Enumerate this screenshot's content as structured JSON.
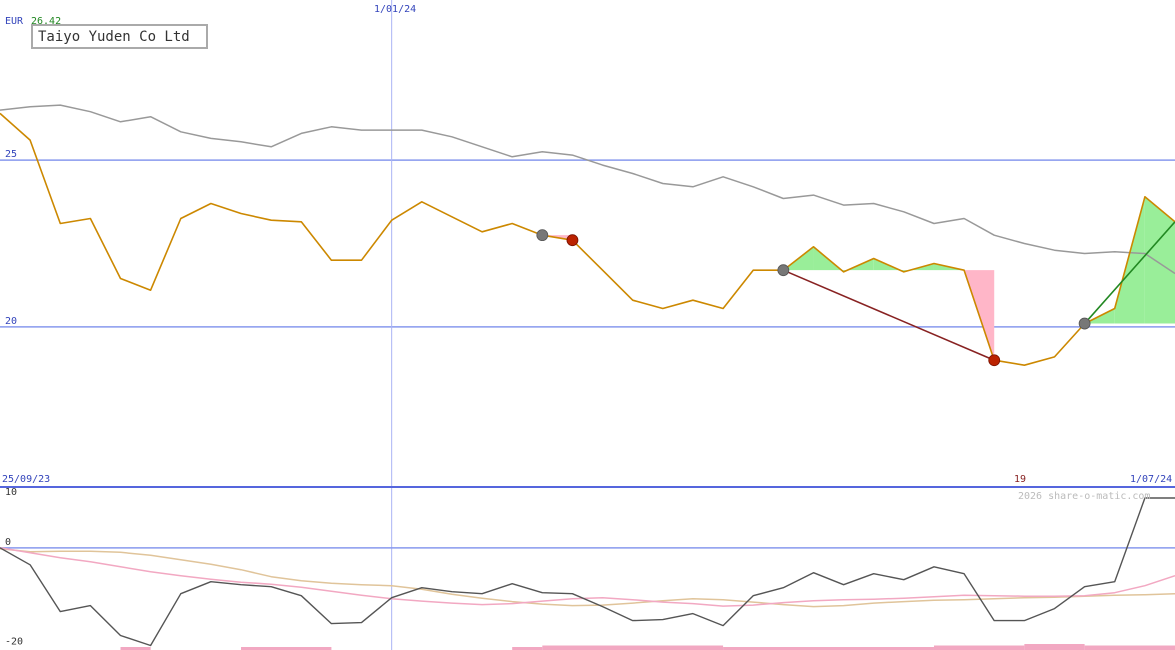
{
  "header": {
    "currency": "EUR",
    "last_price": "26.42",
    "company": "Taiyo Yuden Co Ltd"
  },
  "dates": {
    "start": "25/09/23",
    "mid": "1/01/24",
    "end": "1/07/24"
  },
  "copyright": "2026 share-o-matic.com",
  "marker_label": "19",
  "colors": {
    "price": "#cc8800",
    "average": "#999999",
    "hline": "#8899ee",
    "vline": "#aab4f4",
    "buy_fill": "#99ee99",
    "sell_fill": "#ffb6c8",
    "signal_down": "#882222",
    "signal_up": "#228822",
    "point_grey": "#777777",
    "point_red": "#bb2200",
    "osc_main": "#555555",
    "osc_pink": "#f2a8c2",
    "osc_tan": "#e0c49a",
    "last_price_color": "#228822",
    "label_blue": "#3344bb",
    "label_dark": "#882222"
  },
  "chart_data": [
    {
      "type": "line",
      "title": "Taiyo Yuden Co Ltd",
      "ylabel": "EUR",
      "yticks": [
        20,
        25
      ],
      "ylim": [
        15.2,
        29.8
      ],
      "xlim": [
        0,
        39
      ],
      "x_tick_labels": [
        {
          "x": 0,
          "label": "25/09/23"
        },
        {
          "x": 13,
          "label": "1/01/24"
        },
        {
          "x": 39,
          "label": "1/07/24"
        }
      ],
      "series": [
        {
          "key": "price",
          "values": [
            26.4,
            25.6,
            23.1,
            23.25,
            21.45,
            21.1,
            23.25,
            23.7,
            23.4,
            23.2,
            23.15,
            22.0,
            22.0,
            23.2,
            23.75,
            23.3,
            22.85,
            23.1,
            22.75,
            22.6,
            21.7,
            20.8,
            20.55,
            20.8,
            20.55,
            21.7,
            21.7,
            22.4,
            21.65,
            22.05,
            21.65,
            21.9,
            21.7,
            19.0,
            18.85,
            19.1,
            20.1,
            20.55,
            23.9,
            23.15
          ]
        },
        {
          "key": "average",
          "values": [
            26.5,
            26.6,
            26.65,
            26.45,
            26.15,
            26.3,
            25.85,
            25.65,
            25.55,
            25.4,
            25.8,
            26.0,
            25.9,
            25.9,
            25.9,
            25.7,
            25.4,
            25.1,
            25.25,
            25.15,
            24.85,
            24.6,
            24.3,
            24.2,
            24.5,
            24.2,
            23.85,
            23.95,
            23.65,
            23.7,
            23.45,
            23.1,
            23.25,
            22.75,
            22.5,
            22.3,
            22.2,
            22.25,
            22.2,
            21.6
          ]
        }
      ],
      "signals": [
        {
          "from_x": 26,
          "from_y": 21.7,
          "to_x": 33,
          "to_y": 19.0,
          "kind": "down"
        },
        {
          "from_x": 36,
          "from_y": 20.1,
          "to_x": 39,
          "to_y": 23.15,
          "kind": "up"
        }
      ],
      "points": [
        {
          "x": 18,
          "y": 22.75,
          "kind": "grey"
        },
        {
          "x": 19,
          "y": 22.6,
          "kind": "red"
        },
        {
          "x": 26,
          "y": 21.7,
          "kind": "grey"
        },
        {
          "x": 33,
          "y": 19.0,
          "kind": "red"
        },
        {
          "x": 36,
          "y": 20.1,
          "kind": "grey"
        }
      ],
      "marker": {
        "x": 33,
        "label": "19"
      }
    },
    {
      "type": "line",
      "yticks": [
        10,
        0,
        -20
      ],
      "ylim": [
        -20.5,
        12.2
      ],
      "xlim": [
        0,
        39
      ],
      "series": [
        {
          "key": "main",
          "values": [
            0,
            -3.4,
            -12.8,
            -11.6,
            -17.6,
            -19.6,
            -9.2,
            -6.8,
            -7.4,
            -7.8,
            -9.6,
            -15.2,
            -15.0,
            -10.0,
            -8.0,
            -8.8,
            -9.2,
            -7.2,
            -9.0,
            -9.2,
            -11.8,
            -14.6,
            -14.4,
            -13.2,
            -15.6,
            -9.6,
            -8.0,
            -5.0,
            -7.4,
            -5.2,
            -6.4,
            -3.8,
            -5.2,
            -14.6,
            -14.6,
            -12.2,
            -7.8,
            -6.8,
            10.0,
            10.0
          ]
        },
        {
          "key": "pink",
          "values": [
            0,
            -1.0,
            -2.0,
            -2.8,
            -3.8,
            -4.8,
            -5.6,
            -6.3,
            -6.9,
            -7.3,
            -7.9,
            -8.7,
            -9.5,
            -10.2,
            -10.7,
            -11.1,
            -11.4,
            -11.2,
            -10.7,
            -10.2,
            -10.0,
            -10.4,
            -10.9,
            -11.2,
            -11.7,
            -11.5,
            -11.0,
            -10.6,
            -10.4,
            -10.3,
            -10.1,
            -9.8,
            -9.5,
            -9.6,
            -9.7,
            -9.7,
            -9.6,
            -9.0,
            -7.6,
            -5.6
          ]
        },
        {
          "key": "tan",
          "values": [
            -0.2,
            -0.8,
            -0.7,
            -0.7,
            -0.9,
            -1.5,
            -2.4,
            -3.3,
            -4.4,
            -5.8,
            -6.6,
            -7.1,
            -7.4,
            -7.6,
            -8.3,
            -9.3,
            -10.1,
            -10.8,
            -11.3,
            -11.6,
            -11.5,
            -11.1,
            -10.6,
            -10.2,
            -10.4,
            -10.9,
            -11.4,
            -11.8,
            -11.6,
            -11.1,
            -10.8,
            -10.5,
            -10.4,
            -10.2,
            -10.0,
            -9.9,
            -9.7,
            -9.5,
            -9.4,
            -9.2
          ]
        }
      ],
      "bars": [
        {
          "from_x": 4,
          "to_x": 5,
          "level": 1
        },
        {
          "from_x": 8,
          "to_x": 11,
          "level": 1
        },
        {
          "from_x": 17,
          "to_x": 18,
          "level": 1
        },
        {
          "from_x": 18,
          "to_x": 24,
          "level": 2
        },
        {
          "from_x": 24,
          "to_x": 31,
          "level": 1
        },
        {
          "from_x": 31,
          "to_x": 34,
          "level": 2
        },
        {
          "from_x": 34,
          "to_x": 36,
          "level": 3
        },
        {
          "from_x": 36,
          "to_x": 39,
          "level": 2
        }
      ]
    }
  ]
}
